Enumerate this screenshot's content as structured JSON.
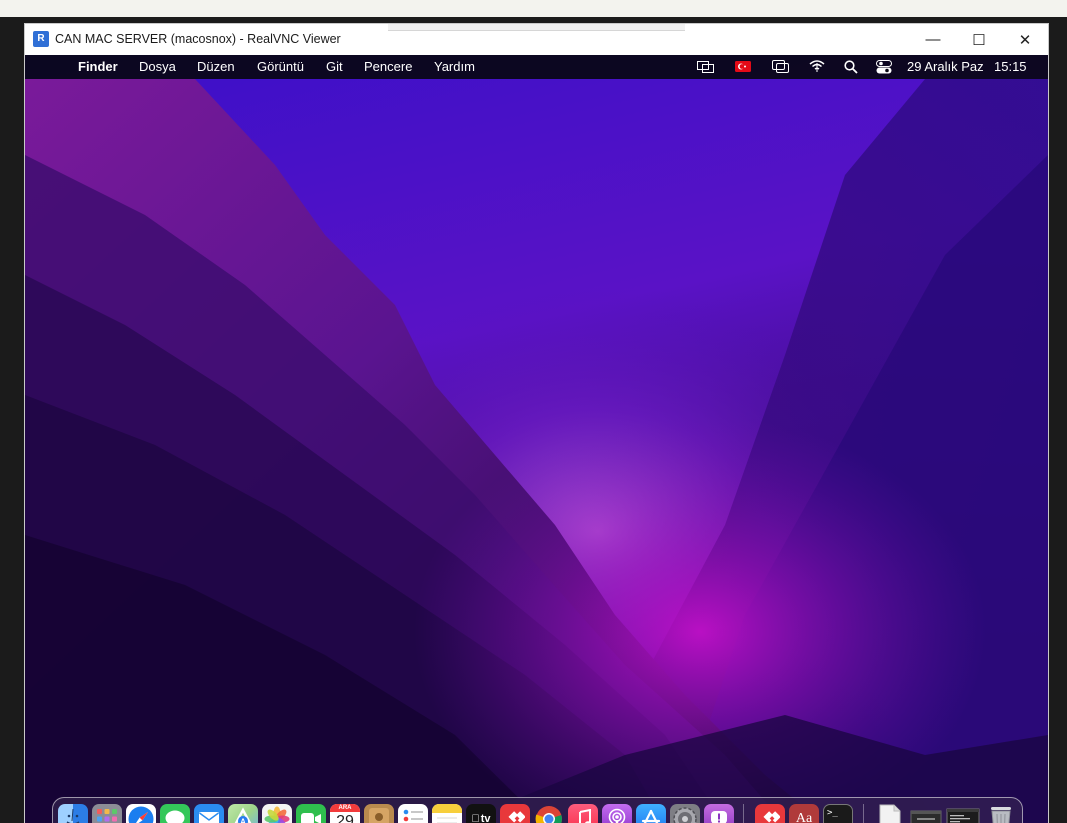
{
  "window": {
    "title": "CAN MAC SERVER (macosnox) - RealVNC Viewer",
    "app_icon_glyph": "R",
    "buttons": {
      "minimize": "—",
      "maximize": "☐",
      "close": "✕"
    }
  },
  "menubar": {
    "apple_glyph": "",
    "app_name": "Finder",
    "items": [
      "Dosya",
      "Düzen",
      "Görüntü",
      "Git",
      "Pencere",
      "Yardım"
    ],
    "date": "29 Aralık Paz",
    "time": "15:15"
  },
  "status_icons": [
    "screen-mirroring-icon",
    "turkish-flag-icon",
    "window-stack-icon",
    "wifi-icon",
    "search-icon",
    "control-center-icon"
  ],
  "colors": {
    "menubar_bg": "#0a0814",
    "wallpaper_dark": "#12062e",
    "wallpaper_purple": "#5a10b8",
    "wallpaper_magenta": "#b010c0",
    "dock_border": "#ffffff"
  },
  "dock": {
    "calendar": {
      "month": "ARA",
      "day": "29"
    },
    "tv_label": "tv",
    "dictionary_label": "Aa",
    "terminal_label": ">_",
    "apps": [
      {
        "name": "finder-icon",
        "color": "#3a8df0"
      },
      {
        "name": "launchpad-icon",
        "color": "#8c8c96"
      },
      {
        "name": "safari-icon",
        "color": "#1b7ef0"
      },
      {
        "name": "messages-icon",
        "color": "#34c75a"
      },
      {
        "name": "mail-icon",
        "color": "#2a8cf0"
      },
      {
        "name": "maps-icon",
        "color": "#4fb35c"
      },
      {
        "name": "photos-icon",
        "color": "#f4f4f4"
      },
      {
        "name": "facetime-icon",
        "color": "#2fbf4e"
      },
      {
        "name": "calendar-icon",
        "color": "#ffffff"
      },
      {
        "name": "contacts-icon",
        "color": "#b98a4e"
      },
      {
        "name": "reminders-icon",
        "color": "#ffffff"
      },
      {
        "name": "notes-icon",
        "color": "#f7cf3c"
      },
      {
        "name": "apple-tv-icon",
        "color": "#111111"
      },
      {
        "name": "anydesk-icon",
        "color": "#e8383b"
      },
      {
        "name": "chrome-icon",
        "color": "#ffffff"
      },
      {
        "name": "music-icon",
        "color": "#fa3c4c"
      },
      {
        "name": "podcasts-icon",
        "color": "#9a45d6"
      },
      {
        "name": "app-store-icon",
        "color": "#1b8cf0"
      },
      {
        "name": "system-preferences-icon",
        "color": "#7e7e84"
      },
      {
        "name": "feedback-icon",
        "color": "#a548c8"
      },
      {
        "name": "anydesk-recent-icon",
        "color": "#e8383b"
      },
      {
        "name": "dictionary-icon",
        "color": "#b03a3a"
      },
      {
        "name": "terminal-icon",
        "color": "#1a1a1a"
      },
      {
        "name": "document-icon",
        "color": "#f2f2f2"
      },
      {
        "name": "chrome-window-thumbnail-icon",
        "color": "#2b2b2b"
      },
      {
        "name": "terminal-window-thumbnail-icon",
        "color": "#1c1c1c"
      },
      {
        "name": "trash-icon",
        "color": "#b9bcc2"
      }
    ]
  }
}
